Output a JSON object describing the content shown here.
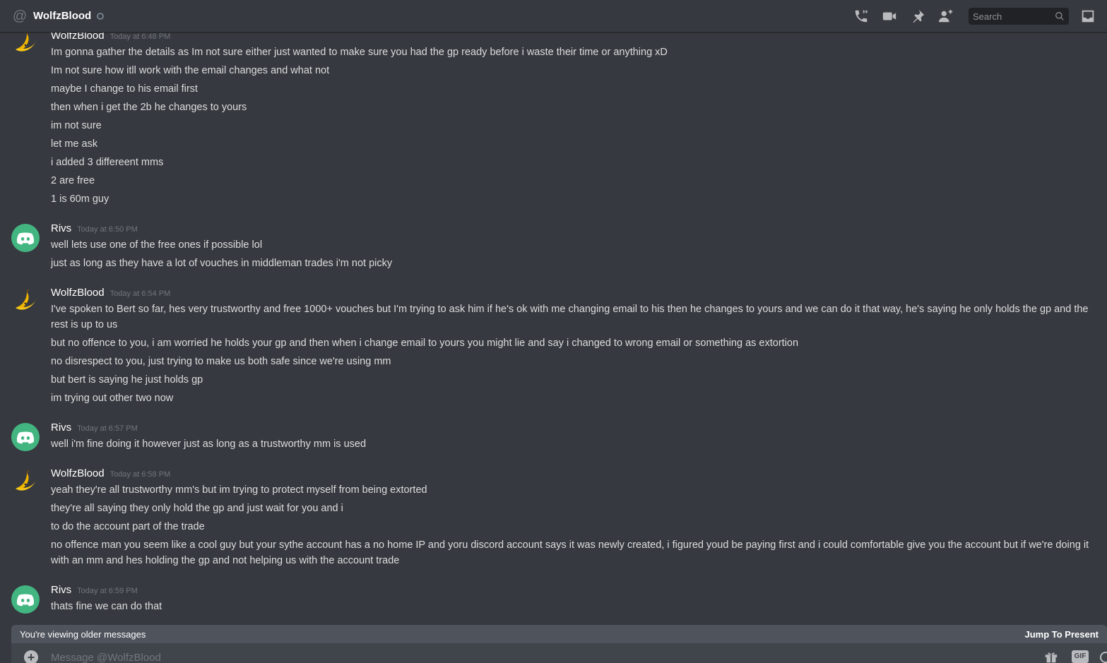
{
  "header": {
    "channel_name": "WolfzBlood",
    "search_placeholder": "Search"
  },
  "groups": [
    {
      "author": "WolfzBlood",
      "avatar": "banana",
      "timestamp": "Today at 6:48 PM",
      "lines": [
        "Im gonna gather the details as Im not sure either just wanted to make sure you had the gp ready before i waste their time or anything xD",
        "Im not sure how itll work with the email changes and what not",
        "maybe I change to his email first",
        "then when i get the 2b he changes to yours",
        "im not sure",
        "let me ask",
        "i added 3 differeent mms",
        "2 are free",
        "1 is 60m guy"
      ]
    },
    {
      "author": "Rivs",
      "avatar": "discord",
      "timestamp": "Today at 6:50 PM",
      "lines": [
        "well lets use one of the free ones if possible lol",
        "just as long as they have a lot of vouches in middleman trades i'm not picky"
      ]
    },
    {
      "author": "WolfzBlood",
      "avatar": "banana",
      "timestamp": "Today at 6:54 PM",
      "lines": [
        "I've spoken to Bert so far, hes very trustworthy and free 1000+ vouches but I'm trying to ask him if he's ok with me changing email to his then he changes to yours and we can do it that way, he's saying he only holds the gp and the rest is up to us",
        "but no offence to you, i am worried he holds your gp and then when i change email to yours you might lie and say i changed to wrong email or something as extortion",
        "no disrespect to you, just trying to make us both safe since we're using mm",
        "but bert is saying he just holds gp",
        "im trying out other two now"
      ]
    },
    {
      "author": "Rivs",
      "avatar": "discord",
      "timestamp": "Today at 6:57 PM",
      "lines": [
        "well i'm fine doing it however just as long as a trustworthy mm is used"
      ]
    },
    {
      "author": "WolfzBlood",
      "avatar": "banana",
      "timestamp": "Today at 6:58 PM",
      "lines": [
        "yeah they're all trustworthy mm's but im trying to protect myself from being extorted",
        "they're all saying they only hold the gp and just wait for you and i",
        "to do the account part of the trade",
        "no offence man you seem like a cool guy but your sythe account has a no home IP and yoru discord account says it was newly created, i figured youd be paying first and i could comfortable give you the account but if we're doing it with an mm and hes holding the gp and not helping us with the account trade"
      ]
    },
    {
      "author": "Rivs",
      "avatar": "discord",
      "timestamp": "Today at 6:59 PM",
      "lines": [
        "thats fine we can do that"
      ]
    }
  ],
  "older_bar": {
    "text": "You're viewing older messages",
    "jump_label": "Jump To Present"
  },
  "composer": {
    "placeholder": "Message @WolfzBlood",
    "gif_label": "GIF"
  },
  "colors": {
    "background": "#36393f",
    "discord_avatar": "#43b581",
    "older_bar": "#4f545c",
    "composer": "#40444b"
  }
}
